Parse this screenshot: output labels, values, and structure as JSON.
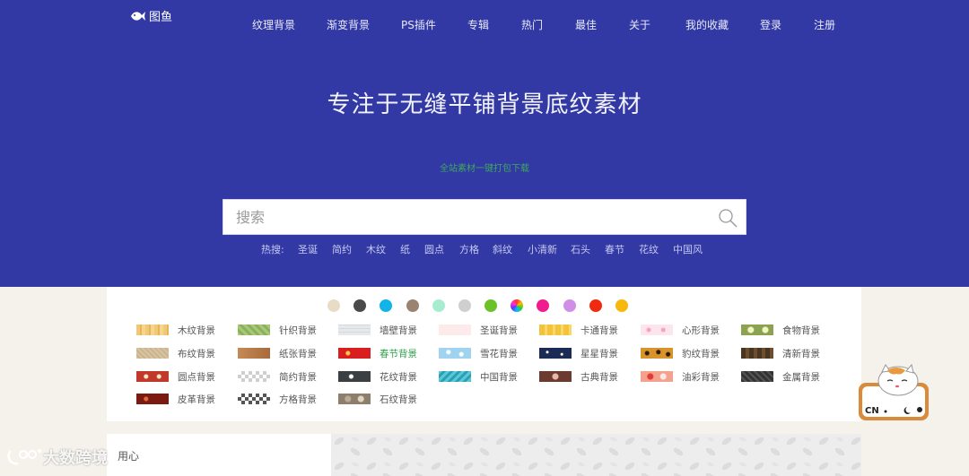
{
  "brand": {
    "name": "图鱼"
  },
  "nav": [
    "纹理背景",
    "渐变背景",
    "PS插件",
    "专辑",
    "热门",
    "最佳",
    "关于",
    "我的收藏",
    "登录",
    "注册"
  ],
  "hero": {
    "headline": "专注于无缝平铺背景底纹素材",
    "promo": "全站素材一键打包下载"
  },
  "search": {
    "placeholder": "搜索"
  },
  "hot": {
    "label": "热搜:",
    "terms": [
      "圣诞",
      "简约",
      "木纹",
      "纸",
      "圆点",
      "方格",
      "斜纹",
      "小清新",
      "石头",
      "春节",
      "花纹",
      "中国风"
    ]
  },
  "colors": [
    "#e8dcc6",
    "#4a4a4a",
    "#12b3e8",
    "#9c8371",
    "#a8ecd0",
    "#cfcfcf",
    "#6bc12a",
    "rainbow",
    "#f01b8c",
    "#d08ee8",
    "#ef2a10",
    "#f8b80b"
  ],
  "categories": [
    {
      "label": "木纹背景",
      "thumb": "wood"
    },
    {
      "label": "针织背景",
      "thumb": "knit"
    },
    {
      "label": "墙壁背景",
      "thumb": "wall"
    },
    {
      "label": "圣诞背景",
      "thumb": "christmas"
    },
    {
      "label": "卡通背景",
      "thumb": "cartoon"
    },
    {
      "label": "心形背景",
      "thumb": "heart"
    },
    {
      "label": "食物背景",
      "thumb": "food"
    },
    {
      "label": "布纹背景",
      "thumb": "cloth"
    },
    {
      "label": "纸张背景",
      "thumb": "paper"
    },
    {
      "label": "春节背景",
      "thumb": "spring"
    },
    {
      "label": "雪花背景",
      "thumb": "snow"
    },
    {
      "label": "星星背景",
      "thumb": "star"
    },
    {
      "label": "豹纹背景",
      "thumb": "leopard"
    },
    {
      "label": "清新背景",
      "thumb": "fresh"
    },
    {
      "label": "圆点背景",
      "thumb": "dots"
    },
    {
      "label": "简约背景",
      "thumb": "simple"
    },
    {
      "label": "花纹背景",
      "thumb": "floral"
    },
    {
      "label": "中国背景",
      "thumb": "chinese"
    },
    {
      "label": "古典背景",
      "thumb": "classic"
    },
    {
      "label": "油彩背景",
      "thumb": "paint"
    },
    {
      "label": "金属背景",
      "thumb": "metal"
    },
    {
      "label": "皮革背景",
      "thumb": "leather"
    },
    {
      "label": "方格背景",
      "thumb": "grid"
    },
    {
      "label": "石纹背景",
      "thumb": "stone"
    }
  ],
  "section2": {
    "title": "用心"
  },
  "mascot": {
    "text": "CN"
  },
  "watermark": {
    "text": "大数跨境"
  }
}
